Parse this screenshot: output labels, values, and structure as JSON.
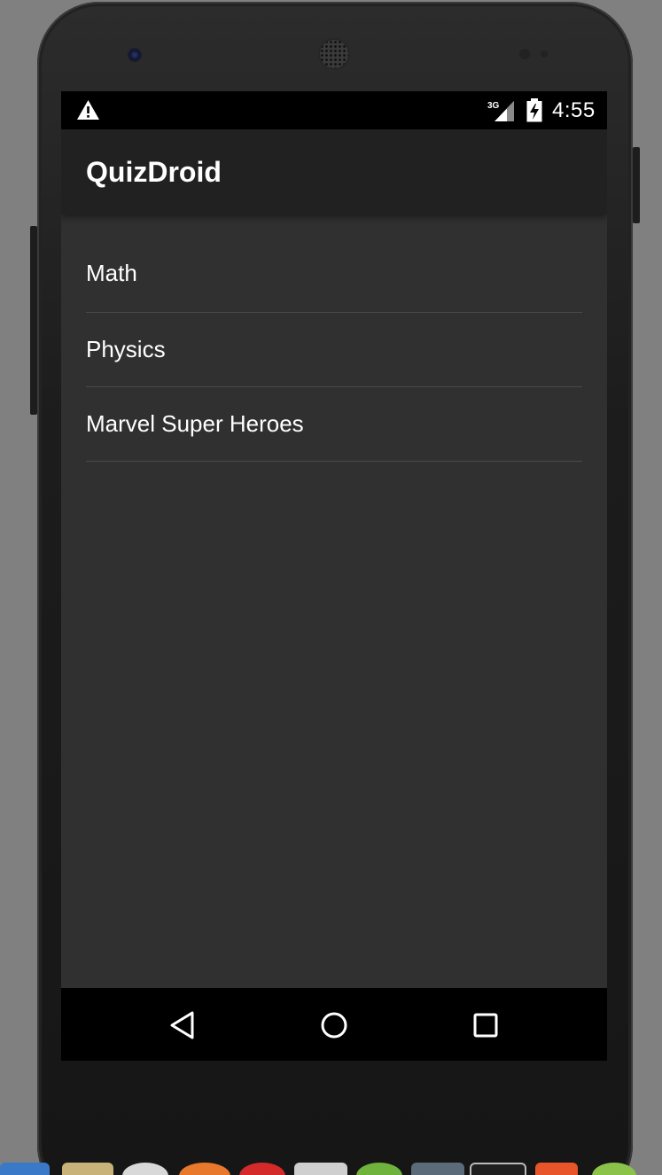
{
  "status_bar": {
    "network_label": "3G",
    "time": "4:55",
    "warning_icon": "warning-icon",
    "signal_icon": "signal-icon",
    "battery_icon": "battery-charging-icon"
  },
  "app_bar": {
    "title": "QuizDroid"
  },
  "topics": [
    {
      "label": "Math"
    },
    {
      "label": "Physics"
    },
    {
      "label": "Marvel Super Heroes"
    }
  ],
  "nav_bar": {
    "back_icon": "back-icon",
    "home_icon": "home-icon",
    "recent_icon": "recent-apps-icon"
  },
  "colors": {
    "screen_background": "#303030",
    "app_bar": "#212121",
    "status_bar": "#000000",
    "nav_bar": "#000000",
    "divider": "#4a4a4a",
    "text": "#ffffff"
  }
}
